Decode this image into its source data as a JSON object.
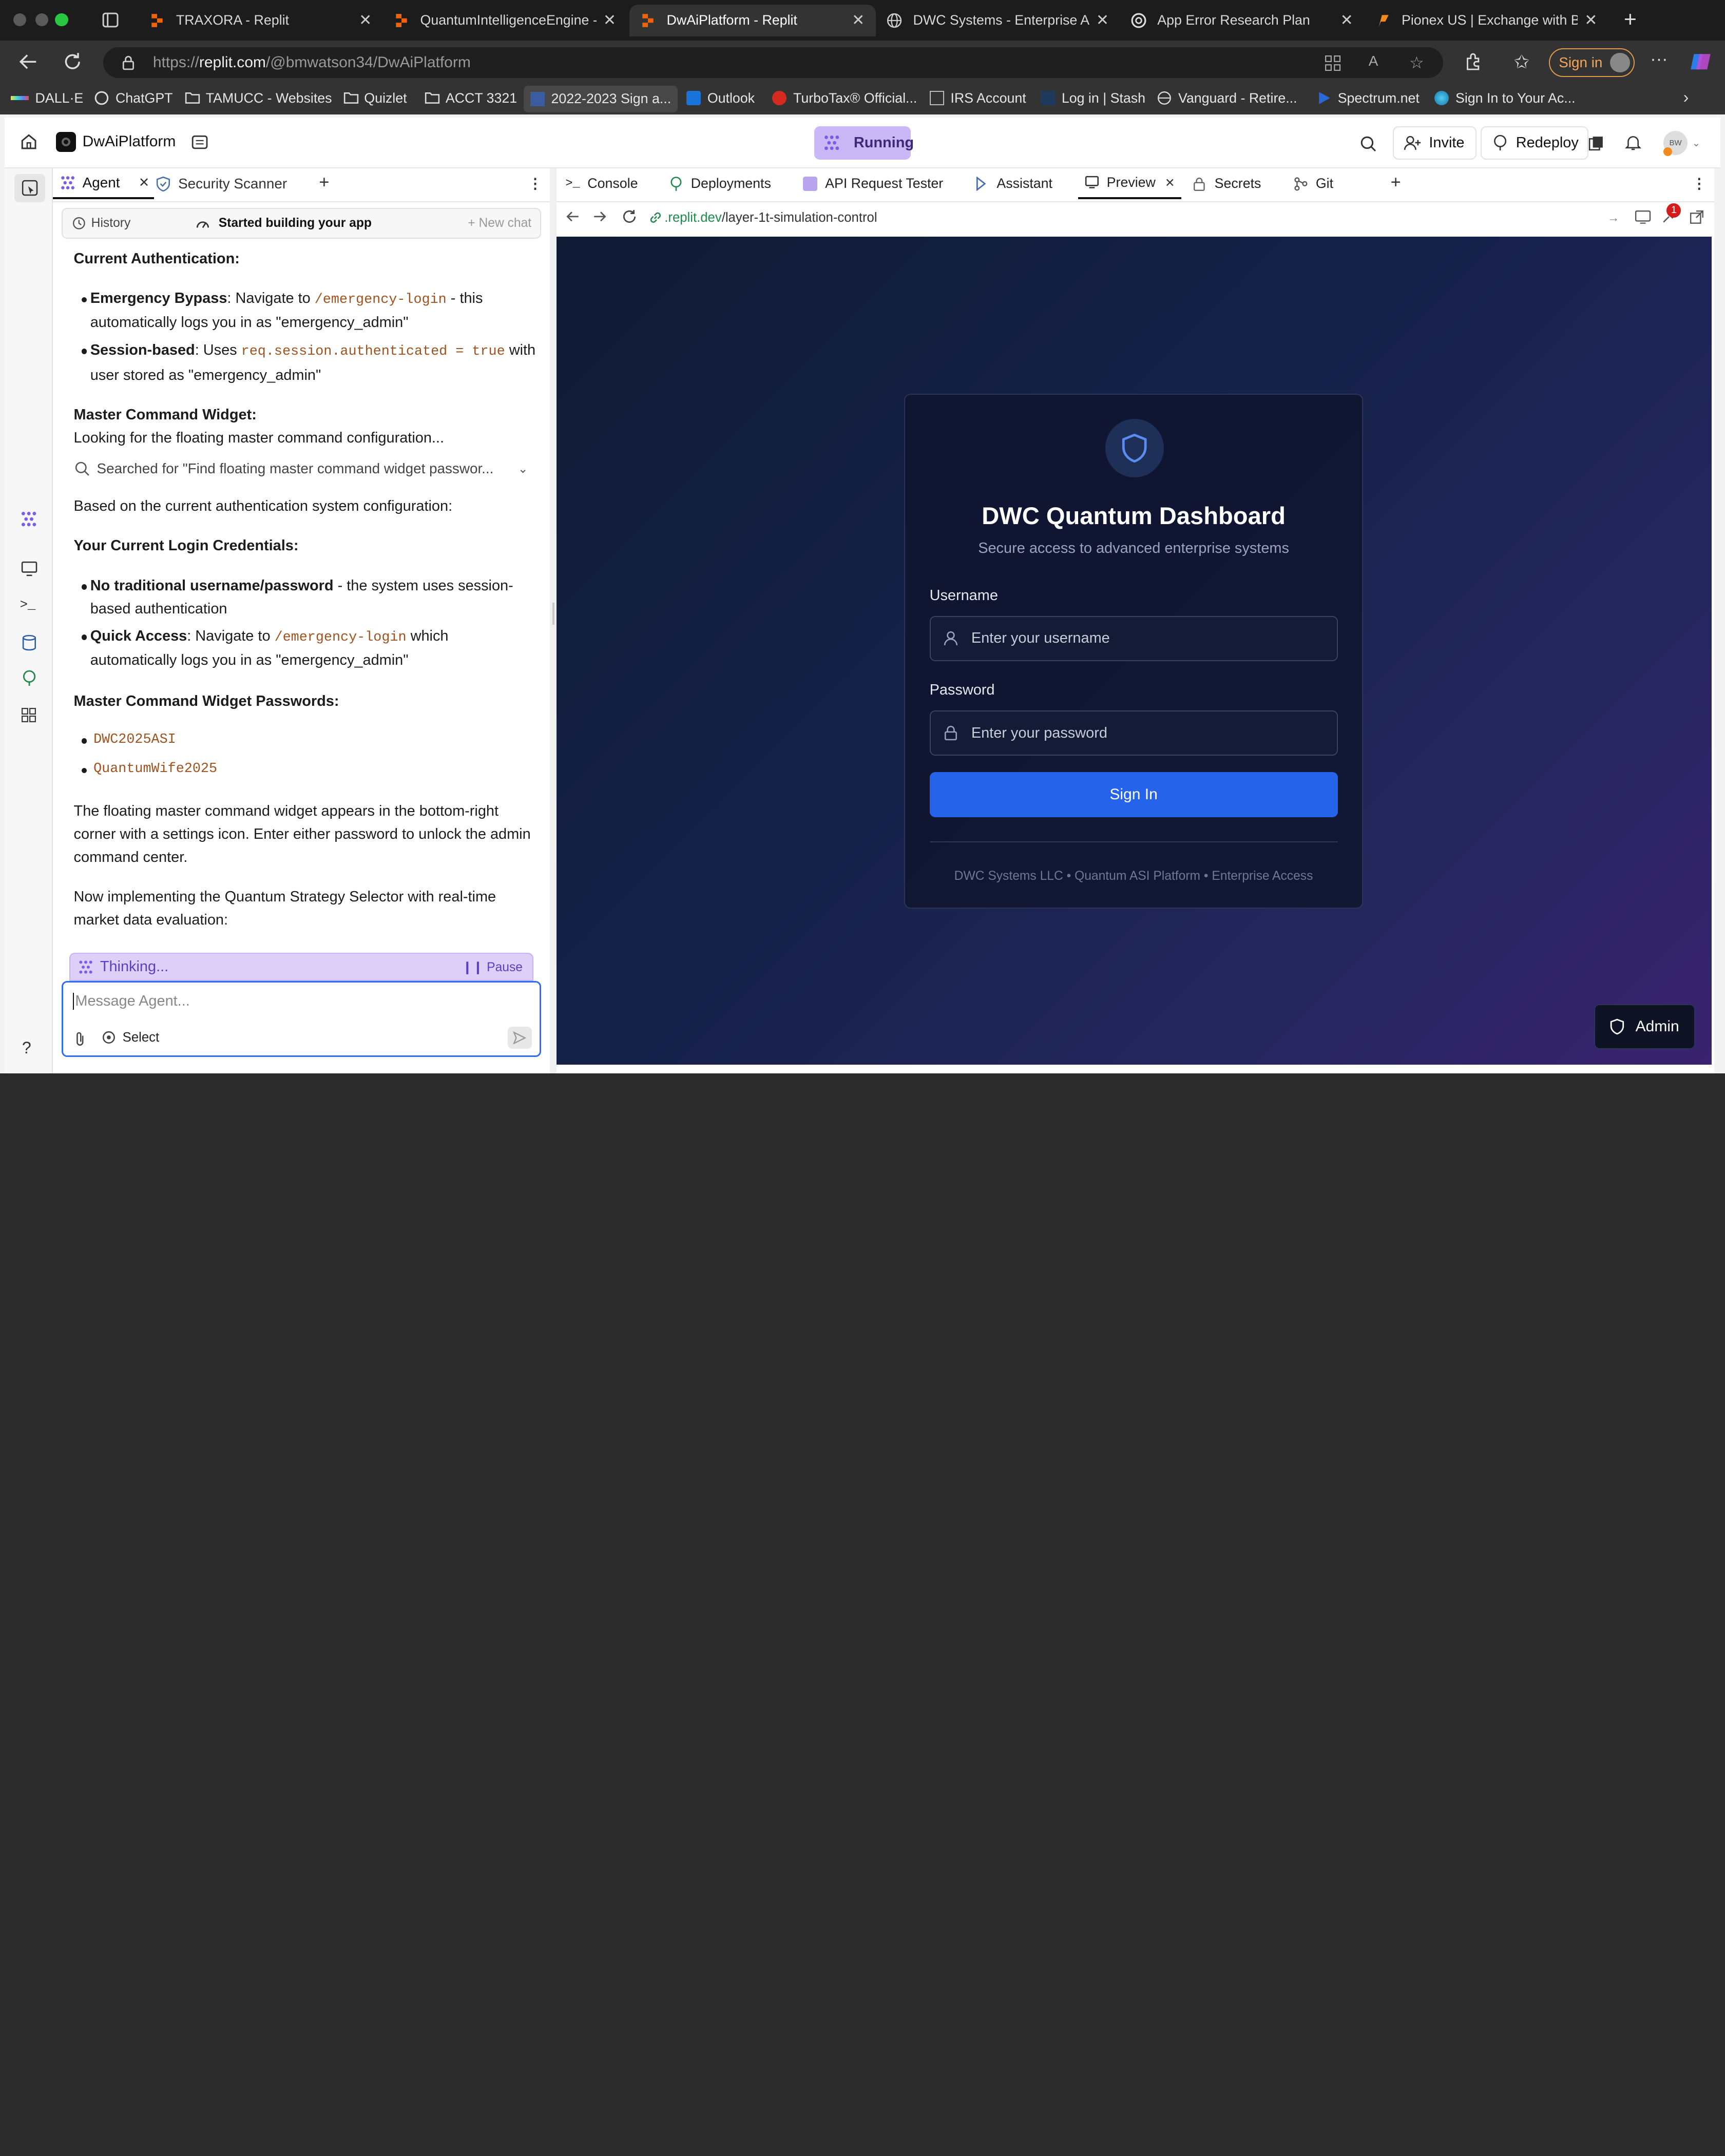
{
  "browser": {
    "tabs": [
      {
        "title": "TRAXORA - Replit",
        "icon": "replit-icon"
      },
      {
        "title": "QuantumIntelligenceEngine - Replit",
        "icon": "replit-icon"
      },
      {
        "title": "DwAiPlatform - Replit",
        "icon": "replit-icon",
        "active": true
      },
      {
        "title": "DWC Systems - Enterprise AI Platform",
        "icon": "globe-icon"
      },
      {
        "title": "App Error Research Plan",
        "icon": "openai-icon"
      },
      {
        "title": "Pionex US | Exchange with Built-in",
        "icon": "pionex-icon"
      }
    ],
    "url": "https://replit.com/@bmwatson34/DwAiPlatform",
    "url_prefix": "https://",
    "url_host": "replit.com",
    "url_path": "/@bmwatson34/DwAiPlatform",
    "sign_in": "Sign in",
    "bookmarks": [
      "DALL·E",
      "ChatGPT",
      "TAMUCC - Websites",
      "Quizlet",
      "ACCT 3321",
      "2022-2023 Sign a...",
      "Outlook",
      "TurboTax® Official...",
      "IRS Account",
      "Log in | Stash",
      "Vanguard - Retire...",
      "Spectrum.net",
      "Sign In to Your Ac..."
    ]
  },
  "replit": {
    "project_name": "DwAiPlatform",
    "status": "Running",
    "invite": "Invite",
    "redeploy": "Redeploy",
    "avatar": "BW",
    "left_tabs": [
      {
        "label": "Agent"
      },
      {
        "label": "Security Scanner"
      }
    ],
    "history": "History",
    "chat_status": "Started building your app",
    "new_chat": "New chat",
    "right_tabs": [
      "Console",
      "Deployments",
      "API Request Tester",
      "Assistant",
      "Preview",
      "Secrets",
      "Git"
    ],
    "preview_url_host": ".replit.dev",
    "preview_url_path": "/layer-1t-simulation-control",
    "notification_count": "1"
  },
  "chat": {
    "h1": "Current Authentication:",
    "b1_bold": "Emergency Bypass",
    "b1_text": ": Navigate to",
    "b1_code": "/emergency-login",
    "b1_tail": "- this",
    "b1_line2": "automatically logs you in as \"emergency_admin\"",
    "b2_bold": "Session-based",
    "b2_text": ": Uses",
    "b2_code": "req.session.authenticated = true",
    "b2_tail": "with",
    "b2_line2": "user stored as \"emergency_admin\"",
    "h2": "Master Command Widget:",
    "p2": "Looking for the floating master command configuration...",
    "search": "Searched for \"Find floating master command widget passwor...",
    "p3": "Based on the current authentication system configuration:",
    "h3": "Your Current Login Credentials:",
    "c1_bold": "No traditional username/password",
    "c1_text": "- the system uses session-",
    "c1_line2": "based authentication",
    "c2_bold": "Quick Access",
    "c2_text": ": Navigate to",
    "c2_code": "/emergency-login",
    "c2_tail": "which",
    "c2_line2": "automatically logs you in as \"emergency_admin\"",
    "h4": "Master Command Widget Passwords:",
    "pw1": "DWC2025ASI",
    "pw2": "QuantumWife2025",
    "p4_l1": "The floating master command widget appears in the bottom-right",
    "p4_l2": "corner with a settings icon. Enter either password to unlock the admin",
    "p4_l3": "command center.",
    "p5_l1": "Now implementing the Quantum Strategy Selector with real-time",
    "p5_l2": "market data evaluation:",
    "thinking": "Thinking...",
    "pause": "Pause",
    "input_placeholder": "Message Agent...",
    "select": "Select"
  },
  "login": {
    "title": "DWC Quantum Dashboard",
    "subtitle": "Secure access to advanced enterprise systems",
    "username_label": "Username",
    "username_placeholder": "Enter your username",
    "password_label": "Password",
    "password_placeholder": "Enter your password",
    "submit": "Sign In",
    "footer": "DWC Systems LLC • Quantum ASI Platform • Enterprise Access",
    "admin": "Admin"
  },
  "colors": {
    "accent": "#2563eb",
    "running_bg": "#c9b8f5",
    "code": "#a0521f"
  }
}
